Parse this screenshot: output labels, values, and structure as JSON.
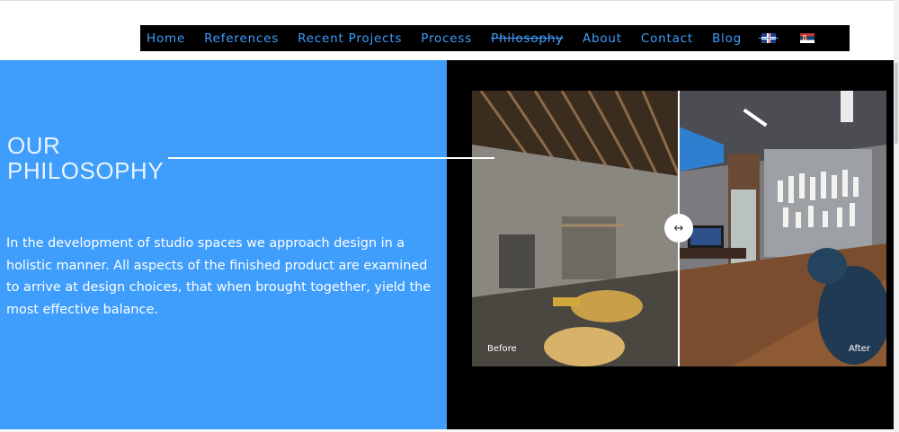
{
  "nav": {
    "items": [
      {
        "label": "Home"
      },
      {
        "label": "References"
      },
      {
        "label": "Recent Projects"
      },
      {
        "label": "Process"
      },
      {
        "label": "Philosophy",
        "active": true
      },
      {
        "label": "About"
      },
      {
        "label": "Contact"
      },
      {
        "label": "Blog"
      }
    ],
    "languages": [
      "english-flag-icon",
      "serbian-flag-icon"
    ]
  },
  "section": {
    "heading_line1": "OUR",
    "heading_line2": "PHILOSOPHY",
    "body": "In the development of studio spaces we approach design in a holistic manner. All aspects of the finished product are examined to arrive at design choices, that when brought together, yield the most effective balance."
  },
  "comparison": {
    "before_label": "Before",
    "after_label": "After",
    "slider_icon": "horizontal-arrows-icon",
    "position": 0.5
  },
  "colors": {
    "accent": "#3f9dfc",
    "nav_background": "#000000",
    "panel_dark": "#000000",
    "text_light": "#ffffff"
  }
}
